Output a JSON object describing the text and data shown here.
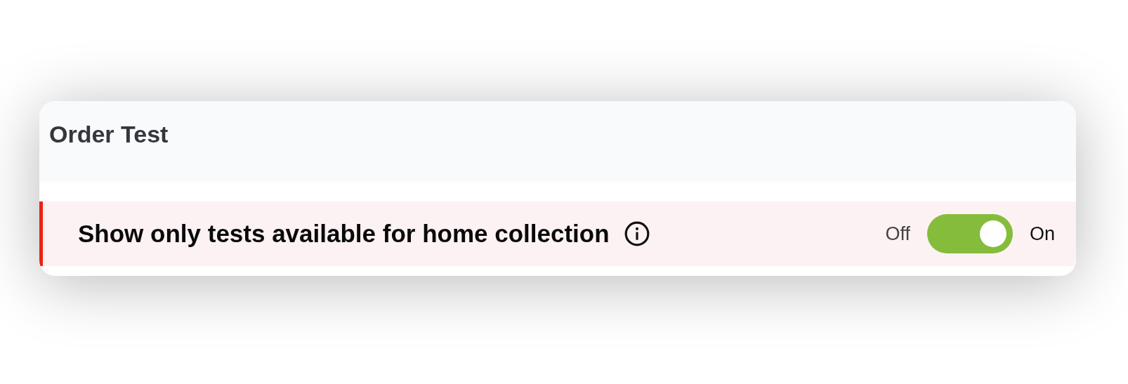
{
  "card": {
    "title": "Order Test"
  },
  "filter": {
    "label": "Show only tests available for home collection",
    "off_label": "Off",
    "on_label": "On",
    "on": true
  }
}
